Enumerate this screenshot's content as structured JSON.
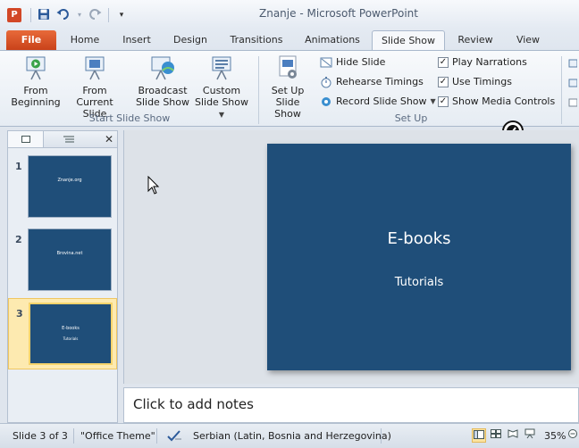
{
  "titlebar": {
    "app_icon_letter": "P",
    "window_title": "Znanje  -  Microsoft PowerPoint",
    "qat": [
      "save-icon",
      "undo-icon",
      "redo-icon",
      "customize-icon"
    ]
  },
  "tabs": [
    "File",
    "Home",
    "Insert",
    "Design",
    "Transitions",
    "Animations",
    "Slide Show",
    "Review",
    "View"
  ],
  "active_tab": "Slide Show",
  "ribbon": {
    "start_group": {
      "label": "Start Slide Show",
      "from_beginning": [
        "From",
        "Beginning"
      ],
      "from_current": [
        "From",
        "Current Slide"
      ],
      "broadcast": [
        "Broadcast",
        "Slide Show"
      ],
      "custom": [
        "Custom",
        "Slide Show"
      ]
    },
    "setup_group": {
      "label": "Set Up",
      "setup_btn": [
        "Set Up",
        "Slide Show"
      ],
      "hide_slide": "Hide Slide",
      "rehearse": "Rehearse Timings",
      "record": "Record Slide Show",
      "play_narrations": "Play Narrations",
      "use_timings": "Use Timings",
      "show_media_controls": "Show Media Controls",
      "check_mark": "✓"
    }
  },
  "panel": {
    "close": "✕",
    "slides": [
      {
        "num": "1",
        "title": "Znanje.org",
        "subtitle": ""
      },
      {
        "num": "2",
        "title": "Brovina.net",
        "subtitle": ""
      },
      {
        "num": "3",
        "title": "E-books",
        "subtitle": "Tutorials"
      }
    ]
  },
  "slide": {
    "title": "E-books",
    "subtitle": "Tutorials"
  },
  "notes": {
    "placeholder": "Click to add notes"
  },
  "status": {
    "slide_counter": "Slide 3 of 3",
    "theme": "\"Office Theme\"",
    "language": "Serbian (Latin, Bosnia and Herzegovina)",
    "zoom": "35%"
  },
  "colors": {
    "slide_bg": "#1f4e79",
    "file_tab": "#d24726"
  }
}
